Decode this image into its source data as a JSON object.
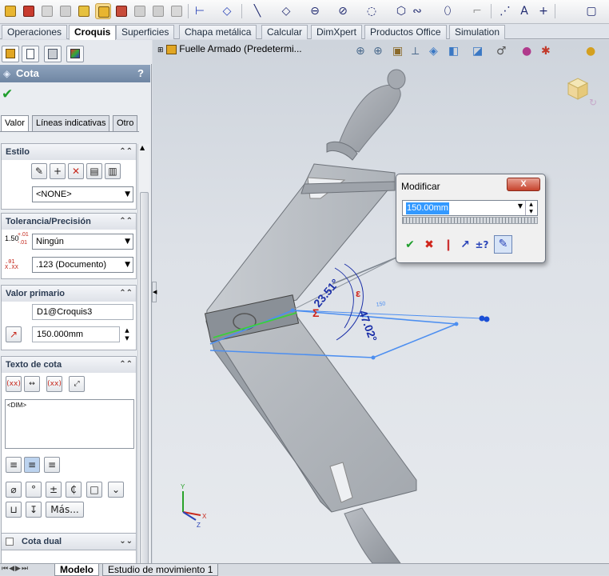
{
  "command_tabs": [
    "Operaciones",
    "Croquis",
    "Superficies",
    "Chapa metálica",
    "Calcular",
    "DimXpert",
    "Productos Office",
    "Simulation"
  ],
  "active_command_tab": "Croquis",
  "property_manager": {
    "title": "Cota",
    "help": "?",
    "subtabs": [
      "Valor",
      "Líneas indicativas",
      "Otro"
    ],
    "active_subtab": "Valor",
    "estilo": {
      "header": "Estilo",
      "style_select": "<NONE>"
    },
    "tolerancia": {
      "header": "Tolerancia/Precisión",
      "tol_icon_text": "1.50",
      "tol_icon_sup": "+.01",
      "tol_icon_sub": "-.01",
      "tolerance_select": "Ningún",
      "precision_select": ".123 (Documento)"
    },
    "valor_primario": {
      "header": "Valor primario",
      "name": "D1@Croquis3",
      "value": "150.000mm"
    },
    "texto_cota": {
      "header": "Texto de cota",
      "text": "<DIM>",
      "more_button": "Más..."
    },
    "cota_dual": "Cota dual"
  },
  "viewport": {
    "tree_label": "Fuelle Armado  (Predetermi...",
    "angle_dim_1": "23.51°",
    "angle_dim_2": "47.02°",
    "sketch_dim": "150"
  },
  "modify_dialog": {
    "title": "Modificar",
    "value": "150.00mm",
    "close": "X",
    "tol_button": "±?"
  },
  "bottom_tabs": [
    "Modelo",
    "Estudio de movimiento 1"
  ],
  "colors": {
    "accent": "#3399ff",
    "sketch": "#4d8ff0",
    "dim_text": "#1b2fa8"
  }
}
